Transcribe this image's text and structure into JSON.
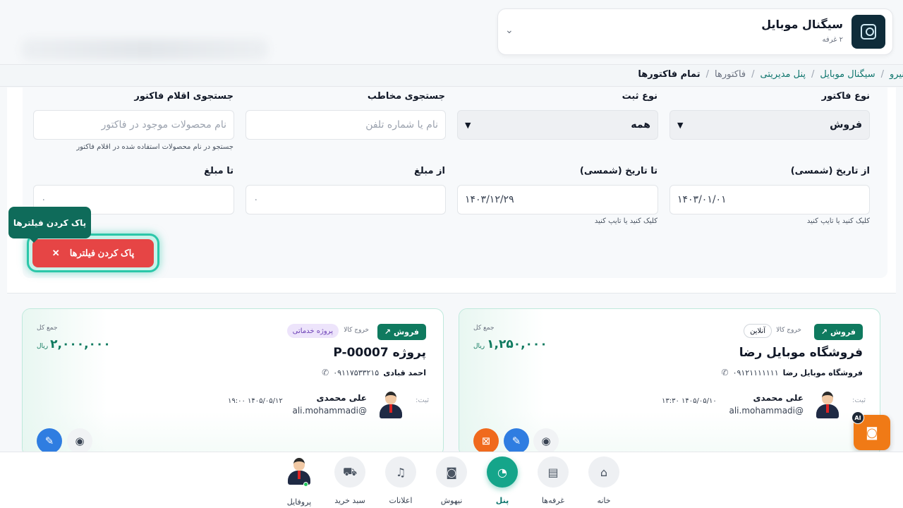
{
  "store": {
    "name": "سیگنال موبایل",
    "subtitle": "۲ غرفه"
  },
  "breadcrumb": {
    "items": [
      "نیرو",
      "سیگنال موبایل",
      "پنل مدیریتی",
      "فاکتورها",
      "تمام فاکتورها"
    ],
    "separator": "/"
  },
  "filters": {
    "invoice_type": {
      "label": "نوع فاکتور",
      "value": "فروش"
    },
    "register_type": {
      "label": "نوع ثبت",
      "value": "همه"
    },
    "contact_search": {
      "label": "جستجوی مخاطب",
      "placeholder": "نام یا شماره تلفن"
    },
    "items_search": {
      "label": "جستجوی اقلام فاکتور",
      "placeholder": "نام محصولات موجود در فاکتور",
      "hint": "جستجو در نام محصولات استفاده شده در اقلام فاکتور"
    },
    "from_date": {
      "label": "از تاریخ (شمسی)",
      "value": "۱۴۰۳/۰۱/۰۱",
      "hint": "کلیک کنید یا تایپ کنید"
    },
    "to_date": {
      "label": "تا تاریخ (شمسی)",
      "value": "۱۴۰۳/۱۲/۲۹",
      "hint": "کلیک کنید یا تایپ کنید"
    },
    "from_amount": {
      "label": "از مبلغ",
      "value": "۰"
    },
    "to_amount": {
      "label": "تا مبلغ",
      "value": "۰"
    },
    "clear_label": "پاک کردن فیلترها",
    "tooltip": "پاک کردن فیلترها"
  },
  "invoices": [
    {
      "badge": "فروش",
      "out_tag": "خروج کالا",
      "chip": "آنلاین",
      "title": "فروشگاه موبایل رضا",
      "contact_name": "فروشگاه موبایل رضا",
      "phone": "۰۹۱۲۱۱۱۱۱۱۱",
      "total_label": "جمع کل",
      "total": "۱,۲۵۰,۰۰۰",
      "currency": "ریال",
      "reg_label": "ثبت:",
      "user_name": "علی محمدی",
      "user_email": "ali.mohammadi@",
      "date": "۱۴۰۵/۰۵/۱۰ ۱۳:۳۰"
    },
    {
      "badge": "فروش",
      "out_tag": "خروج کالا",
      "chip": "پروژه خدماتی",
      "title": "پروژه P-00007",
      "contact_name": "احمد قبادی",
      "phone": "۰۹۱۱۷۵۳۳۲۱۵",
      "total_label": "جمع کل",
      "total": "۲,۰۰۰,۰۰۰",
      "currency": "ریال",
      "reg_label": "ثبت:",
      "user_name": "علی محمدی",
      "user_email": "ali.mohammadi@",
      "date": "۱۴۰۵/۰۵/۱۲ ۱۹:۰۰"
    }
  ],
  "ai_badge": "AI",
  "bottom_nav": {
    "home": "خانه",
    "booths": "غرفه‌ها",
    "panel": "پنل",
    "niyhoosh": "نیهوش",
    "notifications": "اعلانات",
    "cart": "سبد خرید",
    "profile": "پروفایل"
  },
  "colors": {
    "primary": "#0f7a5f",
    "accent_teal": "#15a58a",
    "danger": "#e64545",
    "edit": "#2f7de1",
    "delete": "#f06a1d",
    "ai": "#f07a16"
  }
}
